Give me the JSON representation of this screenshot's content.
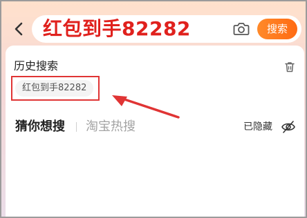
{
  "header": {
    "back_icon": "chevron-left-icon",
    "search_query": "红包到手82282",
    "camera_icon": "camera-icon",
    "search_button_label": "搜索"
  },
  "history": {
    "title": "历史搜索",
    "delete_icon": "trash-icon",
    "items": [
      {
        "label": "红包到手82282"
      }
    ]
  },
  "suggestions": {
    "tabs": [
      {
        "label": "猜你想搜",
        "active": true
      },
      {
        "label": "淘宝热搜",
        "active": false
      }
    ],
    "hide_label": "已隐藏",
    "hide_icon": "eye-off-icon"
  },
  "colors": {
    "accent_orange": "#ff6a12",
    "query_red": "#e0211d",
    "annotation_red": "#e03434"
  }
}
